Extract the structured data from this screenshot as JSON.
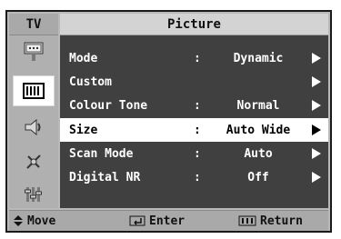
{
  "header": {
    "section": "TV",
    "title": "Picture"
  },
  "sidebar": {
    "items": [
      {
        "icon": "input-icon",
        "active": false
      },
      {
        "icon": "picture-icon",
        "active": true
      },
      {
        "icon": "sound-icon",
        "active": false
      },
      {
        "icon": "channel-icon",
        "active": false
      },
      {
        "icon": "setup-icon",
        "active": false
      }
    ]
  },
  "menu": {
    "rows": [
      {
        "label": "Mode",
        "value": "Dynamic",
        "colon": ":"
      },
      {
        "label": "Custom",
        "value": "",
        "colon": ""
      },
      {
        "label": "Colour Tone",
        "value": "Normal",
        "colon": ":"
      },
      {
        "label": "Size",
        "value": "Auto Wide",
        "colon": ":",
        "selected": true
      },
      {
        "label": "Scan Mode",
        "value": "Auto",
        "colon": ":"
      },
      {
        "label": "Digital NR",
        "value": "Off",
        "colon": ":"
      }
    ]
  },
  "footer": {
    "move": "Move",
    "enter": "Enter",
    "return": "Return"
  }
}
